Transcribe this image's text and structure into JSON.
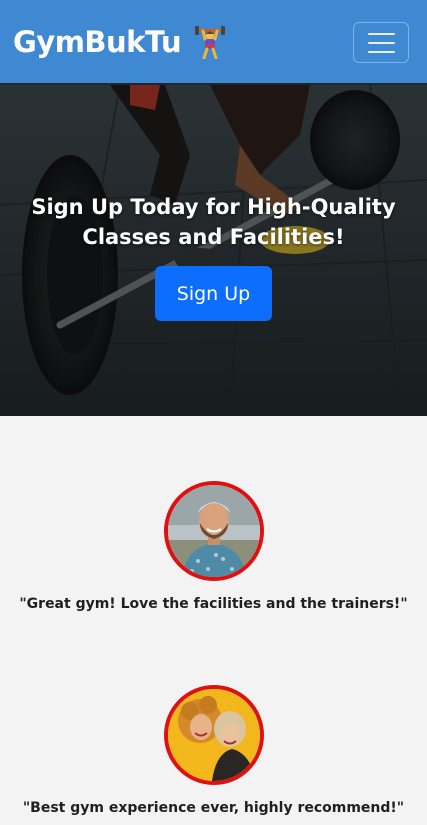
{
  "navbar": {
    "brand": "GymBukTu",
    "brand_icon": "weightlifter-icon",
    "menu_icon": "hamburger-menu-icon",
    "color": "#3f88d2"
  },
  "hero": {
    "title": "Sign Up Today for High-Quality Classes and Facilities!",
    "button_label": "Sign Up",
    "button_color": "#0d6efd"
  },
  "testimonials": [
    {
      "quote": "\"Great gym! Love the facilities and the trainers!\"",
      "avatar": "man-portrait"
    },
    {
      "quote": "\"Best gym experience ever, highly recommend!\"",
      "avatar": "two-women-portrait"
    }
  ],
  "colors": {
    "avatar_border": "#e01010",
    "page_bg": "#f3f3f3"
  }
}
